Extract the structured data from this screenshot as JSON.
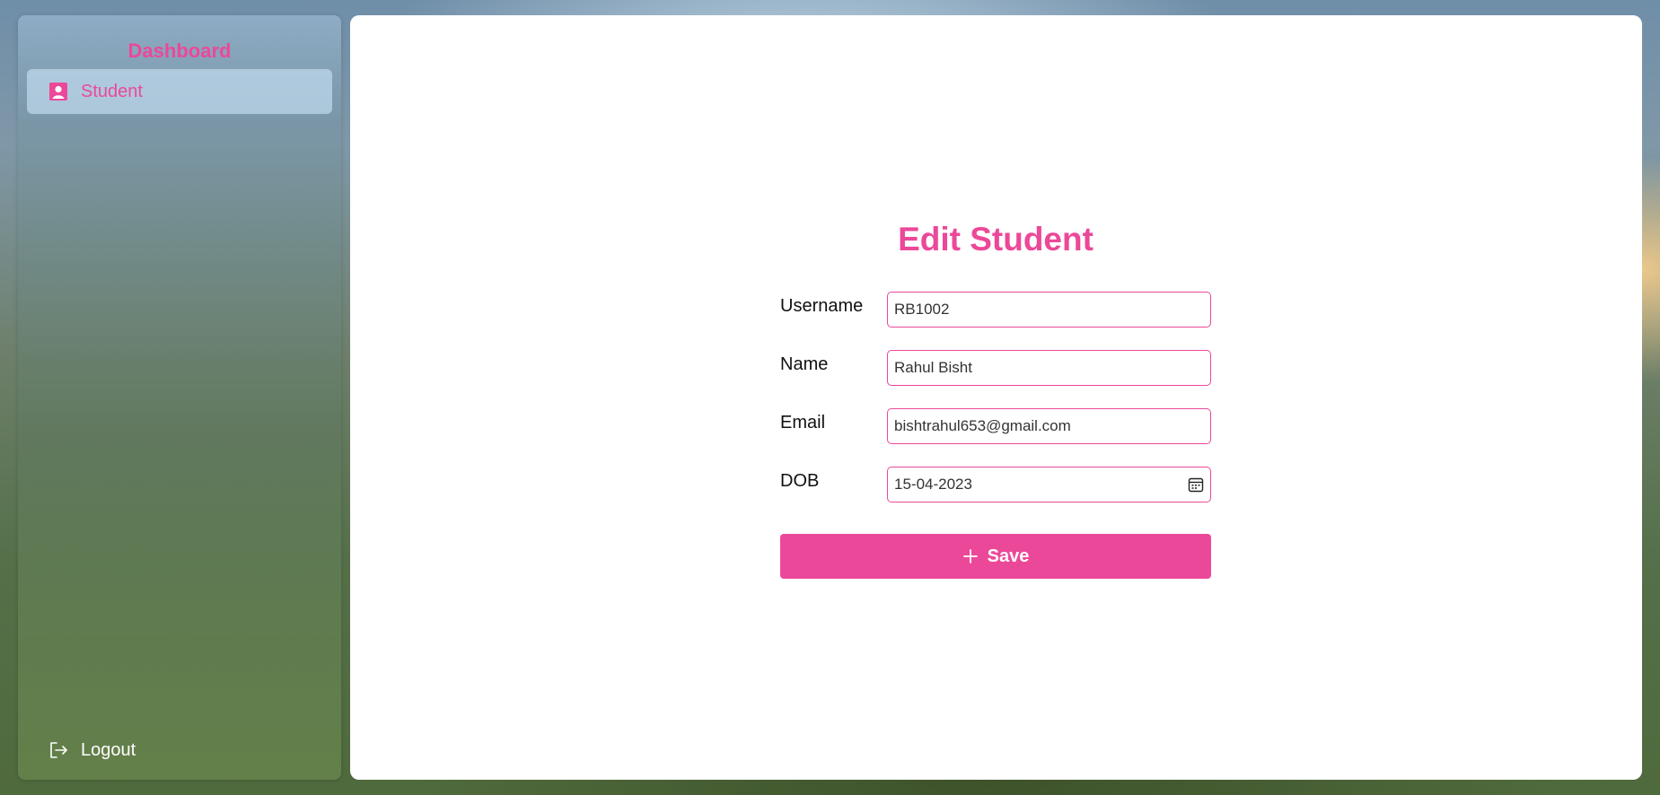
{
  "sidebar": {
    "brand": "Dashboard",
    "items": [
      {
        "label": "Student",
        "icon": "user-square-icon"
      }
    ],
    "logout": {
      "label": "Logout",
      "icon": "logout-icon"
    }
  },
  "form": {
    "title": "Edit Student",
    "fields": [
      {
        "label": "Username",
        "value": "RB1002"
      },
      {
        "label": "Name",
        "value": "Rahul Bisht"
      },
      {
        "label": "Email",
        "value": "bishtrahul653@gmail.com"
      },
      {
        "label": "DOB",
        "value": "15-04-2023"
      }
    ],
    "submit_label": "Save"
  },
  "colors": {
    "accent": "#ec4899",
    "panel": "#ffffff"
  }
}
